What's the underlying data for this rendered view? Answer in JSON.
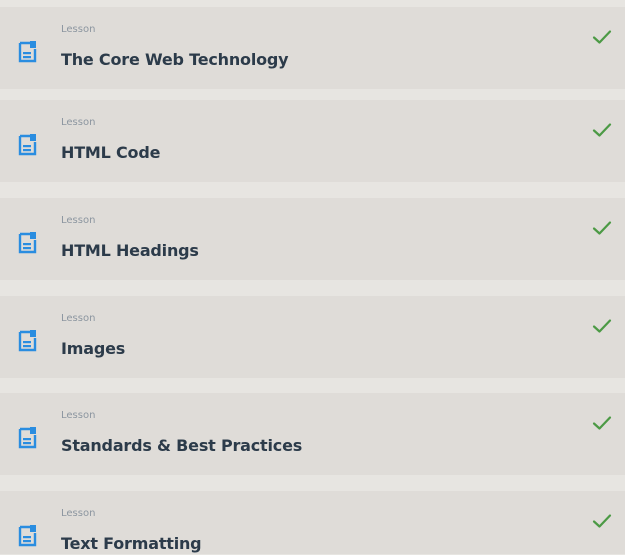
{
  "lessons": [
    {
      "type": "Lesson",
      "title": "The Core Web Technology",
      "completed": true
    },
    {
      "type": "Lesson",
      "title": "HTML Code",
      "completed": true
    },
    {
      "type": "Lesson",
      "title": "HTML Headings",
      "completed": true
    },
    {
      "type": "Lesson",
      "title": "Images",
      "completed": true
    },
    {
      "type": "Lesson",
      "title": "Standards & Best Practices",
      "completed": true
    },
    {
      "type": "Lesson",
      "title": "Text Formatting",
      "completed": true
    }
  ],
  "icons": {
    "lesson": "document-icon",
    "status": "checkmark-icon"
  },
  "colors": {
    "background": "#e7e5e1",
    "card": "#dfdcd8",
    "icon": "#2a8de0",
    "check": "#4c9a45",
    "title": "#2c3b4a",
    "type": "#8c96a0"
  }
}
